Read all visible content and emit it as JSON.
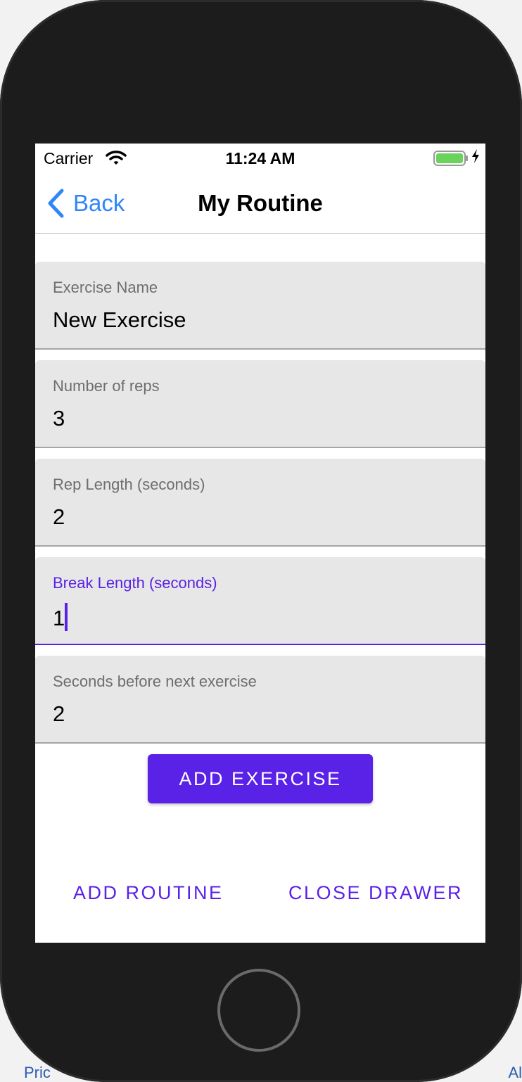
{
  "background": {
    "left_text": "Pric",
    "right_text": "Al"
  },
  "status_bar": {
    "carrier": "Carrier",
    "time": "11:24 AM",
    "icons": [
      "wifi-icon",
      "battery-icon",
      "charging-bolt-icon"
    ],
    "battery_color": "#6ad35c"
  },
  "nav": {
    "back_label": "Back",
    "title": "My Routine",
    "back_color": "#2f86f7"
  },
  "form": {
    "fields": [
      {
        "label": "Exercise Name",
        "value": "New Exercise"
      },
      {
        "label": "Number of reps",
        "value": "3"
      },
      {
        "label": "Rep Length (seconds)",
        "value": "2"
      },
      {
        "label": "Break Length (seconds)",
        "value": "1",
        "focused": true
      },
      {
        "label": "Seconds before next exercise",
        "value": "2"
      }
    ]
  },
  "actions": {
    "add_exercise": "ADD EXERCISE",
    "add_routine": "ADD ROUTINE",
    "close_drawer": "CLOSE DRAWER"
  },
  "colors": {
    "accent": "#5a21e6",
    "field_bg": "#e7e7e7",
    "label": "#6e6e6e"
  }
}
